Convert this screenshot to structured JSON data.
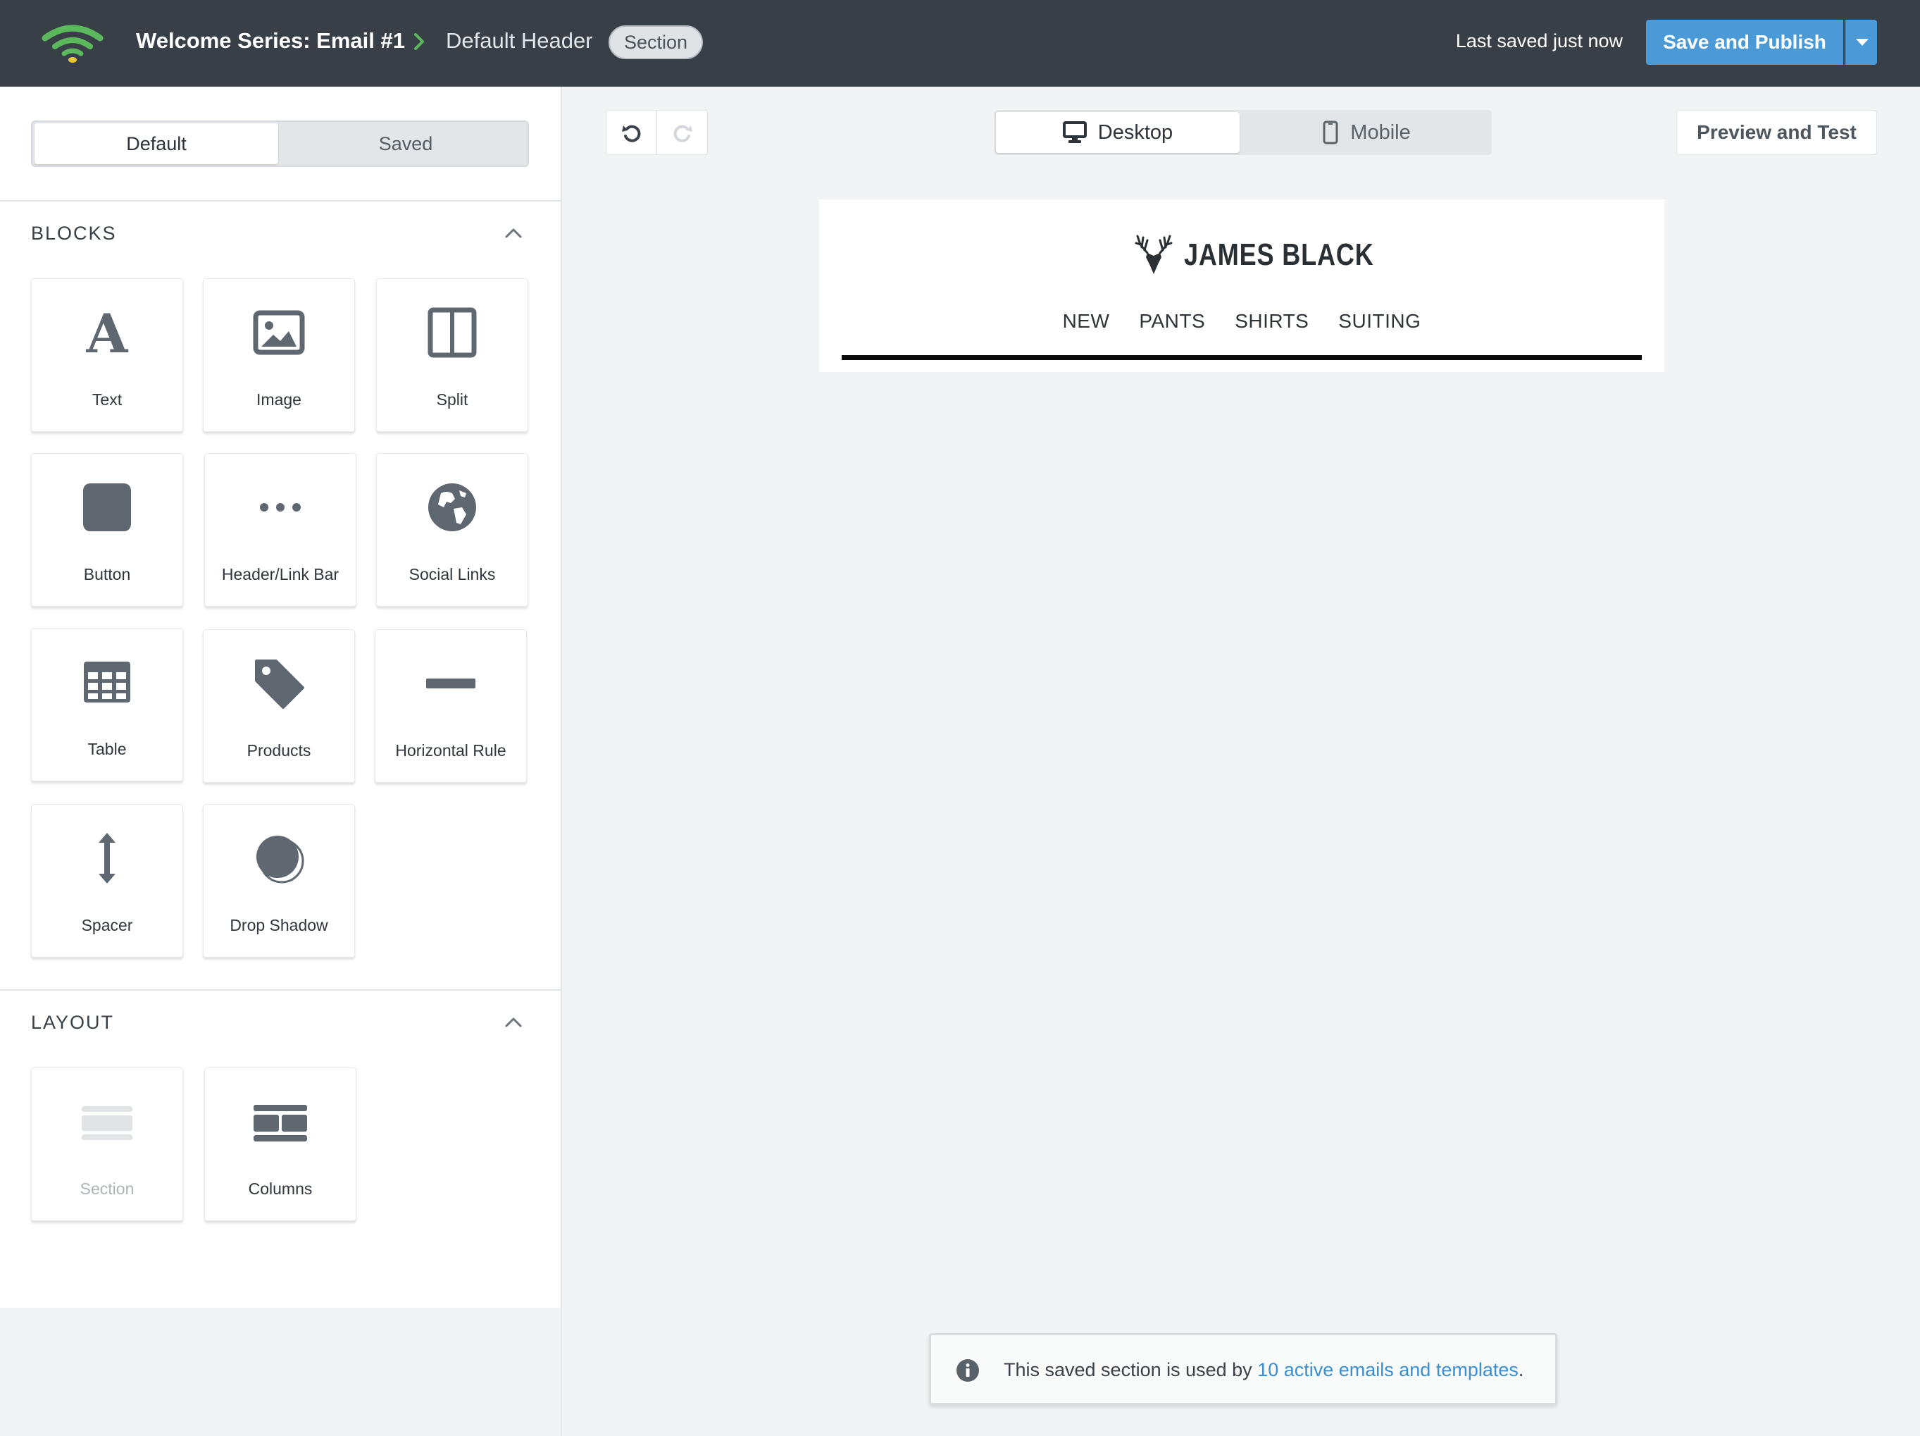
{
  "header": {
    "campaign_title": "Welcome Series: Email #1",
    "current_item": "Default Header",
    "item_badge": "Section",
    "last_saved": "Last saved just now",
    "publish_label": "Save and Publish"
  },
  "sidebar": {
    "tabs": [
      "Default",
      "Saved"
    ],
    "blocks_heading": "BLOCKS",
    "blocks": [
      {
        "label": "Text",
        "icon": "text-icon"
      },
      {
        "label": "Image",
        "icon": "image-icon"
      },
      {
        "label": "Split",
        "icon": "split-icon"
      },
      {
        "label": "Button",
        "icon": "button-icon"
      },
      {
        "label": "Header/Link Bar",
        "icon": "ellipsis-icon"
      },
      {
        "label": "Social Links",
        "icon": "globe-icon"
      },
      {
        "label": "Table",
        "icon": "table-icon"
      },
      {
        "label": "Products",
        "icon": "tag-icon"
      },
      {
        "label": "Horizontal Rule",
        "icon": "horizontal-rule-icon"
      },
      {
        "label": "Spacer",
        "icon": "vertical-arrows-icon"
      },
      {
        "label": "Drop Shadow",
        "icon": "drop-shadow-icon"
      }
    ],
    "layout_heading": "LAYOUT",
    "layout": [
      {
        "label": "Section",
        "icon": "section-icon",
        "disabled": true
      },
      {
        "label": "Columns",
        "icon": "columns-icon",
        "disabled": false
      }
    ]
  },
  "toolbar": {
    "device_modes": [
      "Desktop",
      "Mobile"
    ],
    "active_device": "Desktop",
    "preview_label": "Preview and Test"
  },
  "email": {
    "brand_name": "JAMES BLACK",
    "nav_links": [
      "NEW",
      "PANTS",
      "SHIRTS",
      "SUITING"
    ]
  },
  "notice": {
    "text_before": "This saved section is used by ",
    "link_text": "10 active emails and templates",
    "text_after": "."
  },
  "colors": {
    "topbar": "#383f47",
    "primary": "#4b9ad6",
    "link": "#3a8fd3",
    "icon": "#5f6770",
    "logo_green": "#5cb85c",
    "logo_yellow": "#e8c33a"
  }
}
